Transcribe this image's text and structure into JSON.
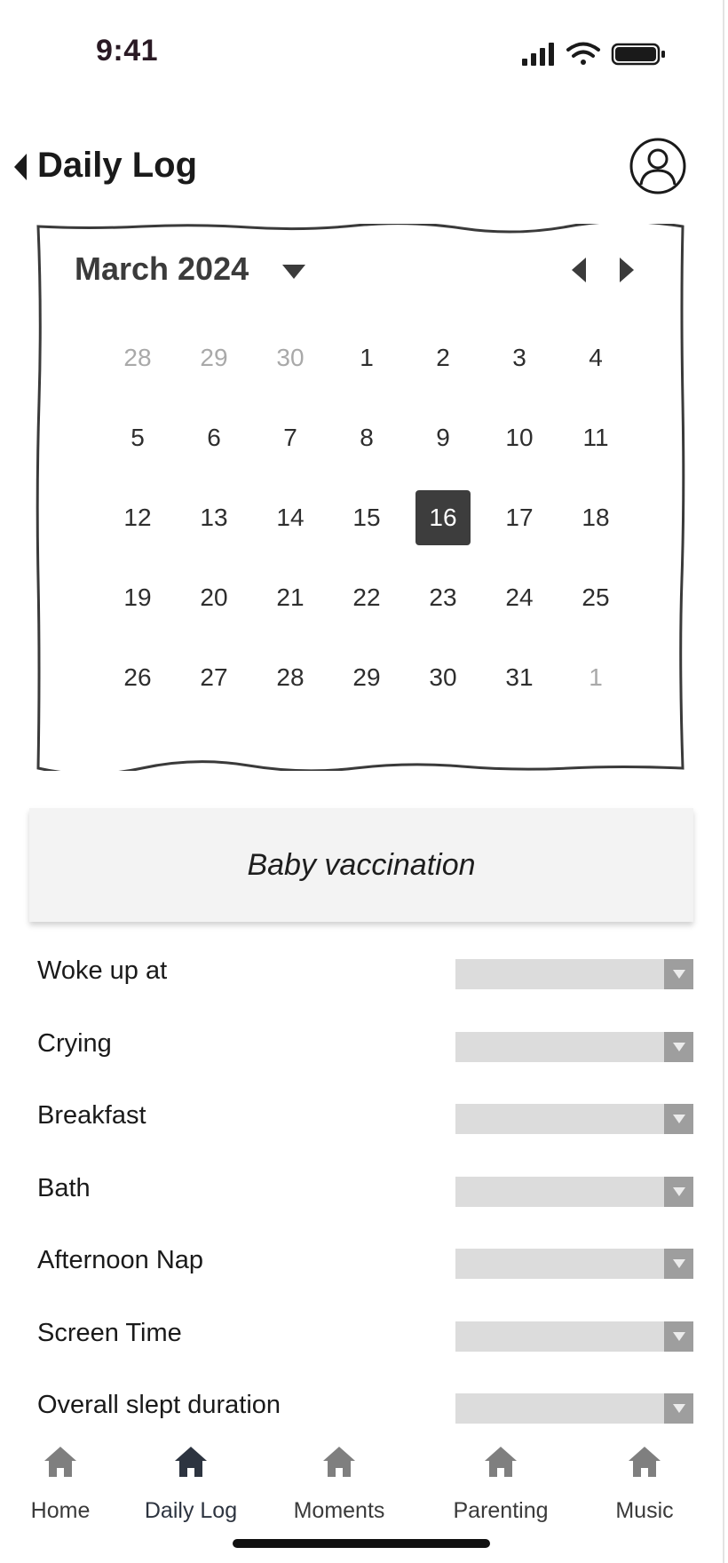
{
  "status_bar": {
    "time": "9:41"
  },
  "header": {
    "title": "Daily Log"
  },
  "calendar": {
    "month_label": "March 2024",
    "selected_day": "16",
    "weeks": [
      [
        {
          "d": "28",
          "muted": true
        },
        {
          "d": "29",
          "muted": true
        },
        {
          "d": "30",
          "muted": true
        },
        {
          "d": "1"
        },
        {
          "d": "2"
        },
        {
          "d": "3"
        },
        {
          "d": "4"
        }
      ],
      [
        {
          "d": "5"
        },
        {
          "d": "6"
        },
        {
          "d": "7"
        },
        {
          "d": "8"
        },
        {
          "d": "9"
        },
        {
          "d": "10"
        },
        {
          "d": "11"
        }
      ],
      [
        {
          "d": "12"
        },
        {
          "d": "13"
        },
        {
          "d": "14"
        },
        {
          "d": "15"
        },
        {
          "d": "16",
          "selected": true
        },
        {
          "d": "17"
        },
        {
          "d": "18"
        }
      ],
      [
        {
          "d": "19"
        },
        {
          "d": "20"
        },
        {
          "d": "21"
        },
        {
          "d": "22"
        },
        {
          "d": "23"
        },
        {
          "d": "24"
        },
        {
          "d": "25"
        }
      ],
      [
        {
          "d": "26"
        },
        {
          "d": "27"
        },
        {
          "d": "28"
        },
        {
          "d": "29"
        },
        {
          "d": "30"
        },
        {
          "d": "31"
        },
        {
          "d": "1",
          "muted": true
        }
      ]
    ]
  },
  "event": {
    "title": "Baby vaccination"
  },
  "log_items": [
    {
      "label": "Woke up at"
    },
    {
      "label": "Crying"
    },
    {
      "label": "Breakfast"
    },
    {
      "label": "Bath"
    },
    {
      "label": "Afternoon Nap"
    },
    {
      "label": "Screen Time"
    },
    {
      "label": "Overall slept duration"
    }
  ],
  "nav": {
    "active": "Daily Log",
    "items": [
      {
        "label": "Home",
        "icon": "home-icon"
      },
      {
        "label": "Daily Log",
        "icon": "home-icon"
      },
      {
        "label": "Moments",
        "icon": "home-icon"
      },
      {
        "label": "Parenting",
        "icon": "home-icon"
      },
      {
        "label": "Music",
        "icon": "home-icon"
      }
    ]
  },
  "colors": {
    "selected_day_bg": "#3d3d3d",
    "nav_active_icon": "#2d3440",
    "nav_icon": "#7f7f7f",
    "select_bg": "#dcdcdc",
    "select_arrow_bg": "#9e9e9e"
  }
}
